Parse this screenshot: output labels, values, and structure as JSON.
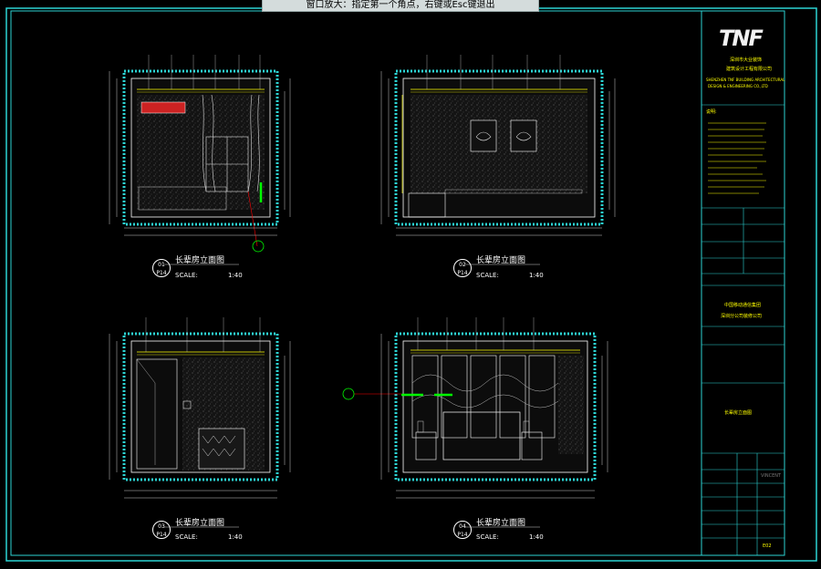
{
  "prompt": {
    "text": "窗口放大：指定第一个角点，右键或Esc键退出"
  },
  "logo": {
    "text": "TNF"
  },
  "elevations": [
    {
      "title": "长辈房立面图",
      "scale": "SCALE:",
      "ratio": "1:40",
      "num": "01",
      "sheet": "P14"
    },
    {
      "title": "长辈房立面图",
      "scale": "SCALE:",
      "ratio": "1:40",
      "num": "02",
      "sheet": "P14"
    },
    {
      "title": "长辈房立面图",
      "scale": "SCALE:",
      "ratio": "1:40",
      "num": "03",
      "sheet": "P14"
    },
    {
      "title": "长辈房立面图",
      "scale": "SCALE:",
      "ratio": "1:40",
      "num": "04",
      "sheet": "P14"
    }
  ],
  "titleblock": {
    "company_cn1": "深圳市大业装饰",
    "company_cn2": "建筑设计工程有限公司",
    "company_en1": "SHENZHEN TNF BUILDING ARCHITECTURAL",
    "company_en2": "DESIGN & ENGINEERING CO.,LTD",
    "notes_head": "说明:",
    "client": "中国移动通信集团",
    "client2": "深圳分公司装修公司",
    "drawing_name": "长辈房立面图",
    "signature": "VINCENT",
    "sheet_no": "E02"
  }
}
